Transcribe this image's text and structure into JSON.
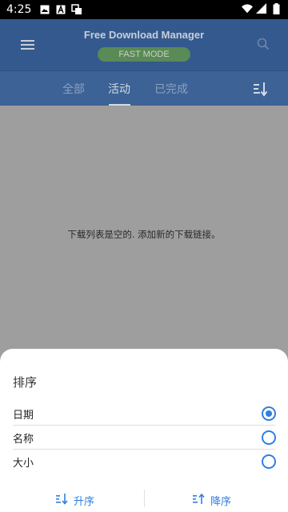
{
  "status_bar": {
    "time": "4:25",
    "left_icons": [
      "image-icon",
      "text-a-icon",
      "screen-icon"
    ],
    "right_icons": [
      "wifi-icon",
      "signal-icon",
      "battery-icon"
    ]
  },
  "app_bar": {
    "title": "Free Download Manager",
    "badge": "FAST MODE",
    "menu_icon": "hamburger-icon",
    "search_icon": "search-icon"
  },
  "tabs": [
    {
      "label": "全部",
      "active": false
    },
    {
      "label": "活动",
      "active": true
    },
    {
      "label": "已完成",
      "active": false
    }
  ],
  "sort_icon": "sort-icon",
  "content": {
    "empty_message": "下载列表是空的. 添加新的下载链接。"
  },
  "sort_sheet": {
    "title": "排序",
    "options": [
      {
        "label": "日期",
        "selected": true
      },
      {
        "label": "名称",
        "selected": false
      },
      {
        "label": "大小",
        "selected": false
      }
    ],
    "ascending_label": "升序",
    "descending_label": "降序"
  },
  "colors": {
    "app_bar": "#34598e",
    "accent": "#2f7fe0",
    "fast_mode": "#5a8a55"
  }
}
